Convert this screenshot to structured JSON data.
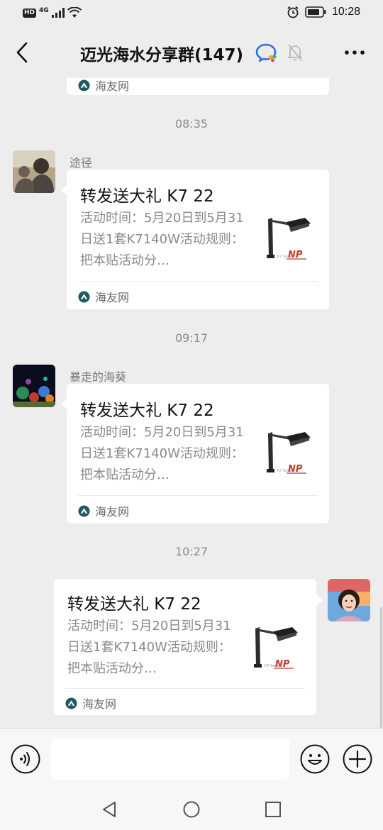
{
  "status_bar": {
    "hd": "HD",
    "network": "4G",
    "time": "10:28"
  },
  "header": {
    "title": "迈光海水分享群(147)",
    "back_icon": "chevron-left-icon",
    "more_icon": "more-horizontal-icon"
  },
  "messages": [
    {
      "type": "card-partial",
      "source": "海友网"
    },
    {
      "type": "time",
      "text": "08:35"
    },
    {
      "type": "card",
      "side": "left",
      "sender": "途径",
      "title": "转发送大礼 K7 22",
      "desc": "活动时间：5月20日到5月31日送1套K7140W活动规则：把本贴活动分…",
      "source": "海友网"
    },
    {
      "type": "time",
      "text": "09:17"
    },
    {
      "type": "card",
      "side": "left",
      "sender": "暴走的海葵",
      "title": "转发送大礼 K7 22",
      "desc": "活动时间：5月20日到5月31日送1套K7140W活动规则：把本贴活动分…",
      "source": "海友网"
    },
    {
      "type": "time",
      "text": "10:27"
    },
    {
      "type": "card",
      "side": "right",
      "title": "转发送大礼 K7 22",
      "desc": "活动时间：5月20日到5月31日送1套K7140W活动规则：把本贴活动分…",
      "source": "海友网"
    }
  ],
  "input_bar": {
    "placeholder": ""
  },
  "colors": {
    "background": "#ededed",
    "bubble": "#ffffff",
    "timestamp": "#8c8c8c"
  }
}
